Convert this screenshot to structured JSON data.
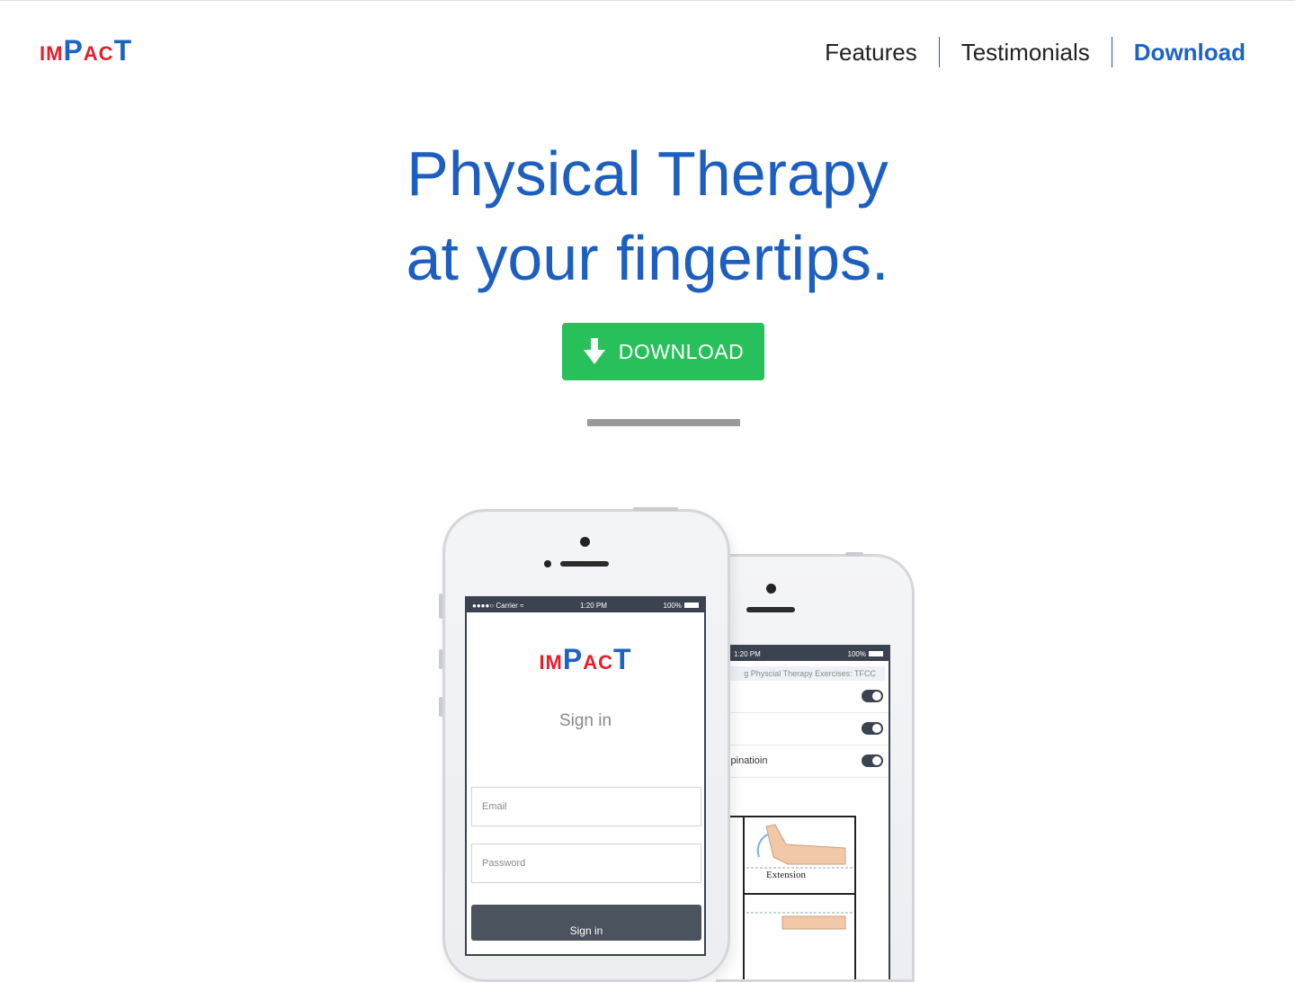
{
  "header": {
    "logo": {
      "part1": "IM",
      "part2": "P",
      "part3": "AC",
      "part4": "T"
    },
    "nav": [
      {
        "label": "Features"
      },
      {
        "label": "Testimonials"
      },
      {
        "label": "Download"
      }
    ]
  },
  "hero": {
    "title_line1": "Physical Therapy",
    "title_line2": "at your fingertips.",
    "download_button": "DOWNLOAD"
  },
  "phone_front": {
    "status": {
      "carrier": "Carrier",
      "time": "1:20 PM",
      "battery": "100%"
    },
    "logo": {
      "part1": "IM",
      "part2": "P",
      "part3": "AC",
      "part4": "T"
    },
    "signin_title": "Sign in",
    "email_placeholder": "Email",
    "password_placeholder": "Password",
    "signin_button": "Sign in"
  },
  "phone_back": {
    "status": {
      "time": "1:20 PM",
      "battery": "100%"
    },
    "search_text": "g Physcial Therapy Exercises: TFCC",
    "rows": [
      {
        "label": ""
      },
      {
        "label": ""
      },
      {
        "label": "/Supinatioin"
      }
    ],
    "image_label": "Extension"
  },
  "colors": {
    "brand_blue": "#1c63c3",
    "brand_red": "#e21f2a",
    "download_green": "#27c05a"
  }
}
